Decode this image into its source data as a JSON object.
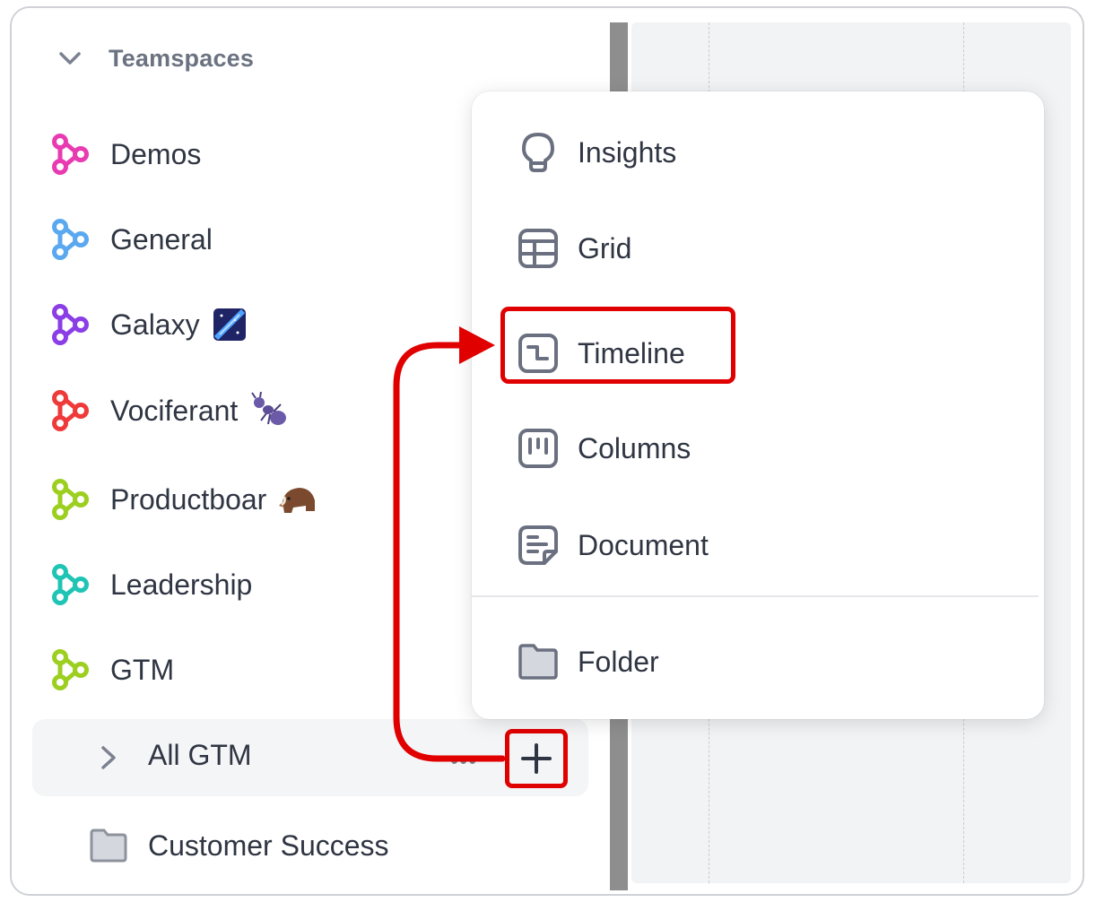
{
  "sidebar": {
    "section_title": "Teamspaces",
    "teamspaces": [
      {
        "label": "Demos",
        "color": "#e83bb2",
        "emoji": ""
      },
      {
        "label": "General",
        "color": "#5aa8f0",
        "emoji": ""
      },
      {
        "label": "Galaxy",
        "color": "#8b3ee6",
        "emoji": "galaxy-emoji"
      },
      {
        "label": "Vociferant",
        "color": "#ef3a3a",
        "emoji": "ant-emoji"
      },
      {
        "label": "Productboar",
        "color": "#9ccf1f",
        "emoji": "boar-emoji"
      },
      {
        "label": "Leadership",
        "color": "#1fc4b5",
        "emoji": ""
      },
      {
        "label": "GTM",
        "color": "#9ccf1f",
        "emoji": ""
      }
    ],
    "sub_item": {
      "label": "All GTM",
      "more": "•••"
    },
    "folder_item": {
      "label": "Customer Success"
    }
  },
  "menu": {
    "items": [
      {
        "label": "Insights",
        "icon": "lightbulb-icon"
      },
      {
        "label": "Grid",
        "icon": "grid-icon"
      },
      {
        "label": "Timeline",
        "icon": "timeline-icon"
      },
      {
        "label": "Columns",
        "icon": "columns-icon"
      },
      {
        "label": "Document",
        "icon": "document-icon"
      }
    ],
    "folder": {
      "label": "Folder",
      "icon": "folder-icon"
    }
  },
  "add_button": {
    "symbol": "+"
  },
  "annotation": {
    "color": "#e00000"
  }
}
